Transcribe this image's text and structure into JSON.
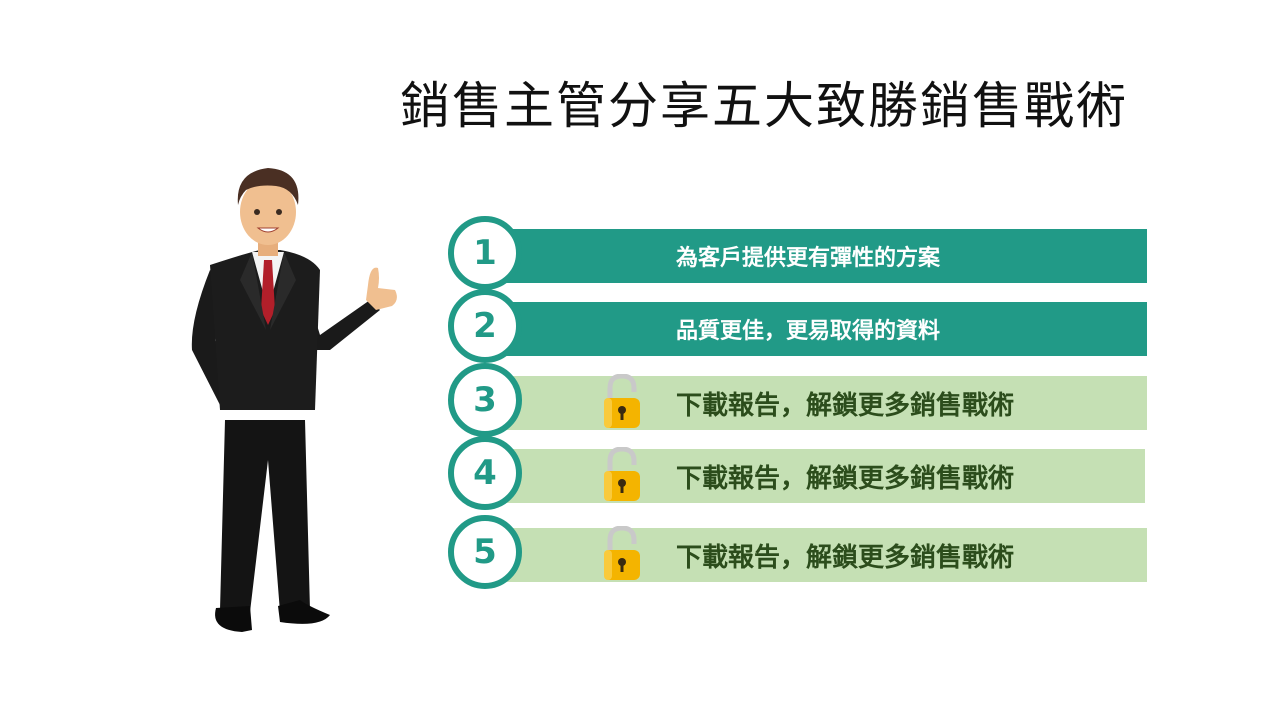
{
  "title": "銷售主管分享五大致勝銷售戰術",
  "items": [
    {
      "number": "1",
      "text": "為客戶提供更有彈性的方案",
      "locked": false
    },
    {
      "number": "2",
      "text": "品質更佳，更易取得的資料",
      "locked": false
    },
    {
      "number": "3",
      "text": "下載報告，解鎖更多銷售戰術",
      "locked": true
    },
    {
      "number": "4",
      "text": "下載報告，解鎖更多銷售戰術",
      "locked": true
    },
    {
      "number": "5",
      "text": "下載報告，解鎖更多銷售戰術",
      "locked": true
    }
  ],
  "colors": {
    "teal": "#219a87",
    "light_green": "#c5e0b4",
    "dark_green_text": "#2c4d1c",
    "lock_gold": "#f4b400"
  },
  "icons": {
    "lock": "lock-icon",
    "person": "businessman-illustration"
  }
}
